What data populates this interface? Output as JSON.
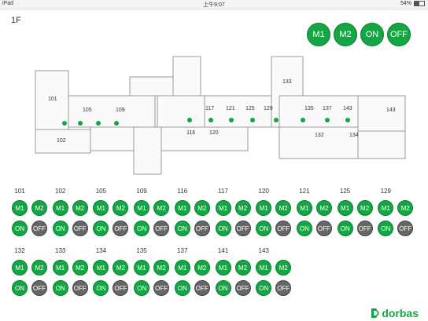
{
  "status": {
    "device": "iPad",
    "time": "上午9:07",
    "battery": "54%",
    "battery_level": 0.54
  },
  "floor": "1F",
  "global": {
    "m1": "M1",
    "m2": "M2",
    "on": "ON",
    "off": "OFF"
  },
  "map": {
    "rooms": [
      "101",
      "105",
      "109",
      "102",
      "133",
      "117",
      "121",
      "125",
      "129",
      "135",
      "137",
      "143",
      "116",
      "120",
      "132",
      "134",
      "143"
    ]
  },
  "rooms_row1": [
    {
      "id": "101",
      "state": "on"
    },
    {
      "id": "102",
      "state": "on"
    },
    {
      "id": "105",
      "state": "on"
    },
    {
      "id": "109",
      "state": "on"
    },
    {
      "id": "116",
      "state": "on"
    },
    {
      "id": "117",
      "state": "on"
    },
    {
      "id": "120",
      "state": "on"
    },
    {
      "id": "121",
      "state": "on"
    },
    {
      "id": "125",
      "state": "on"
    },
    {
      "id": "129",
      "state": "on"
    }
  ],
  "rooms_row2": [
    {
      "id": "132",
      "state": "on"
    },
    {
      "id": "133",
      "state": "on"
    },
    {
      "id": "134",
      "state": "on"
    },
    {
      "id": "135",
      "state": "on"
    },
    {
      "id": "137",
      "state": "on"
    },
    {
      "id": "141",
      "state": "on"
    },
    {
      "id": "143",
      "state": "on"
    }
  ],
  "labels": {
    "m1": "M1",
    "m2": "M2",
    "on": "ON",
    "off": "OFF"
  },
  "brand": "dorbas",
  "colors": {
    "green": "#13a743",
    "gray": "#666666"
  }
}
